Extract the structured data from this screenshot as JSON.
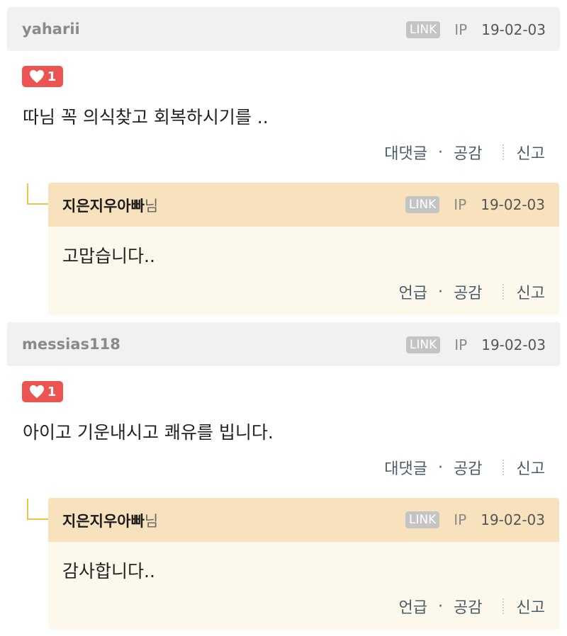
{
  "comments": [
    {
      "author": "yaharii",
      "link_badge": "LINK",
      "ip_label": "IP",
      "date": "19-02-03",
      "like_count": "1",
      "text": "따님 꼭 의식찾고 회복하시기를 ..",
      "actions": {
        "reply": "대댓글",
        "dot": "·",
        "like": "공감",
        "report": "신고"
      },
      "reply": {
        "author": "지은지우아빠",
        "suffix": "님",
        "link_badge": "LINK",
        "ip_label": "IP",
        "date": "19-02-03",
        "text": "고맙습니다..",
        "actions": {
          "mention": "언급",
          "dot": "·",
          "like": "공감",
          "report": "신고"
        }
      }
    },
    {
      "author": "messias118",
      "link_badge": "LINK",
      "ip_label": "IP",
      "date": "19-02-03",
      "like_count": "1",
      "text": "아이고 기운내시고 쾌유를 빕니다.",
      "actions": {
        "reply": "대댓글",
        "dot": "·",
        "like": "공감",
        "report": "신고"
      },
      "reply": {
        "author": "지은지우아빠",
        "suffix": "님",
        "link_badge": "LINK",
        "ip_label": "IP",
        "date": "19-02-03",
        "text": "감사합니다..",
        "actions": {
          "mention": "언급",
          "dot": "·",
          "like": "공감",
          "report": "신고"
        }
      }
    }
  ],
  "colors": {
    "header_bg": "#f1f1f1",
    "reply_header_bg": "#f8e2bd",
    "reply_body_bg": "#fdf8ec",
    "like_badge": "#ec5452",
    "connector": "#f0c14b"
  },
  "icons": {
    "like": "heart-icon"
  }
}
